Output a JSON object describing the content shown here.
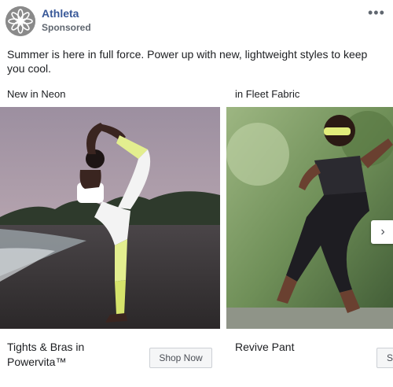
{
  "post": {
    "brand": "Athleta",
    "sponsored": "Sponsored",
    "more_icon": "more-horizontal-icon",
    "text": "Summer is here in full force. Power up with new, lightweight styles to keep you cool."
  },
  "cards": [
    {
      "label": "New in Neon",
      "title": "Tights & Bras in Powervita™",
      "button": "Shop Now"
    },
    {
      "label": "in Fleet Fabric",
      "title": "Revive Pant",
      "button": "Shop Now"
    }
  ],
  "carousel": {
    "next_icon": "chevron-right-icon"
  },
  "colors": {
    "brand_link": "#385898",
    "meta_text": "#606770",
    "button_bg": "#f5f6f7"
  }
}
